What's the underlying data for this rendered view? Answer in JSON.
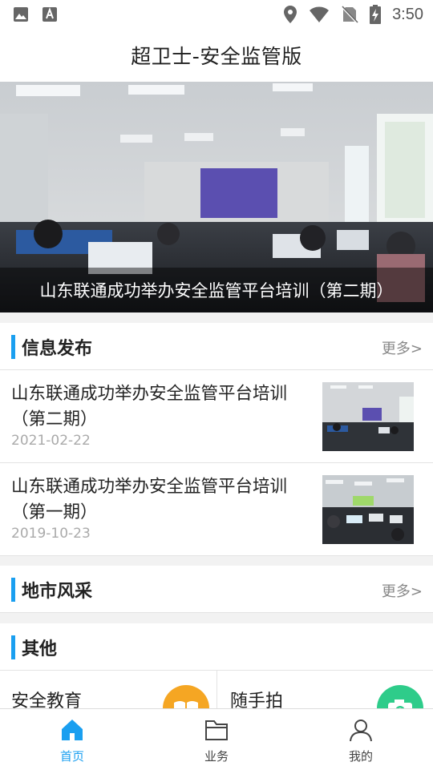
{
  "status_bar": {
    "time": "3:50"
  },
  "app": {
    "title": "超卫士-安全监管版"
  },
  "banner": {
    "caption": "山东联通成功举办安全监管平台培训（第二期）"
  },
  "info_section": {
    "title": "信息发布",
    "more": "更多>",
    "items": [
      {
        "title": "山东联通成功举办安全监管平台培训（第二期）",
        "date": "2021-02-22"
      },
      {
        "title": "山东联通成功举办安全监管平台培训（第一期）",
        "date": "2019-10-23"
      }
    ]
  },
  "city_section": {
    "title": "地市风采",
    "more": "更多>"
  },
  "other_section": {
    "title": "其他",
    "items": [
      {
        "label": "安全教育",
        "icon": "book-icon",
        "color": "#f5a623"
      },
      {
        "label": "随手拍",
        "icon": "camera-icon",
        "color": "#2ecc8a"
      }
    ]
  },
  "bottom_nav": {
    "items": [
      {
        "label": "首页",
        "icon": "home-icon",
        "active": true
      },
      {
        "label": "业务",
        "icon": "folder-icon",
        "active": false
      },
      {
        "label": "我的",
        "icon": "user-icon",
        "active": false
      }
    ]
  },
  "colors": {
    "accent": "#1a9ff0"
  }
}
